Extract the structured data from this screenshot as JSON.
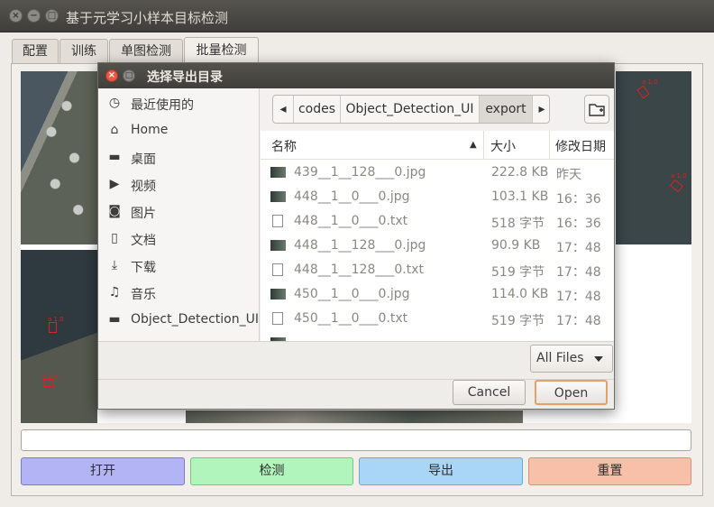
{
  "window": {
    "title": "基于元学习小样本目标检测",
    "close_glyph": "×",
    "min_glyph": "−",
    "max_glyph": "□"
  },
  "tabs": [
    {
      "label": "配置"
    },
    {
      "label": "训练"
    },
    {
      "label": "单图检测"
    },
    {
      "label": "批量检测",
      "active": true
    }
  ],
  "detections": [
    {
      "label": "a 1.0"
    },
    {
      "label": "a 1.0"
    },
    {
      "label": "a 1.0"
    },
    {
      "label": "a 1.0"
    }
  ],
  "path_input": {
    "value": ""
  },
  "actions": [
    {
      "label": "打开",
      "color": "#b3b4f5"
    },
    {
      "label": "检测",
      "color": "#b2f5bc"
    },
    {
      "label": "导出",
      "color": "#a9d6f7"
    },
    {
      "label": "重置",
      "color": "#f8c0a8"
    }
  ],
  "dialog": {
    "title": "选择导出目录",
    "places": [
      {
        "icon": "clock-icon",
        "glyph": "◷",
        "label": "最近使用的"
      },
      {
        "icon": "home-icon",
        "glyph": "⌂",
        "label": "Home"
      },
      {
        "icon": "folder-icon",
        "glyph": "▬",
        "label": "桌面"
      },
      {
        "icon": "video-icon",
        "glyph": "▶",
        "label": "视频"
      },
      {
        "icon": "camera-icon",
        "glyph": "◙",
        "label": "图片"
      },
      {
        "icon": "document-icon",
        "glyph": "▯",
        "label": "文档"
      },
      {
        "icon": "download-icon",
        "glyph": "⤓",
        "label": "下载"
      },
      {
        "icon": "music-icon",
        "glyph": "♫",
        "label": "音乐"
      },
      {
        "icon": "folder-icon",
        "glyph": "▬",
        "label": "Object_Detection_UI"
      }
    ],
    "breadcrumb": {
      "prev_glyph": "◂",
      "next_glyph": "▸",
      "items": [
        {
          "label": "codes"
        },
        {
          "label": "Object_Detection_UI"
        },
        {
          "label": "export",
          "active": true
        }
      ]
    },
    "columns": {
      "name": "名称",
      "size": "大小",
      "modified": "修改日期",
      "sort_glyph": "▲"
    },
    "files": [
      {
        "name": "439__1__128___0.jpg",
        "size": "222.8 KB",
        "modified": "昨天",
        "kind": "image"
      },
      {
        "name": "448__1__0___0.jpg",
        "size": "103.1 KB",
        "modified": "16：36",
        "kind": "image"
      },
      {
        "name": "448__1__0___0.txt",
        "size": "518 字节",
        "modified": "16：36",
        "kind": "text"
      },
      {
        "name": "448__1__128___0.jpg",
        "size": "90.9 KB",
        "modified": "17：48",
        "kind": "image"
      },
      {
        "name": "448__1__128___0.txt",
        "size": "519 字节",
        "modified": "17：48",
        "kind": "text"
      },
      {
        "name": "450__1__0___0.jpg",
        "size": "114.0 KB",
        "modified": "17：48",
        "kind": "image"
      },
      {
        "name": "450__1__0___0.txt",
        "size": "519 字节",
        "modified": "17：48",
        "kind": "text"
      }
    ],
    "filter": {
      "value": "All Files"
    },
    "cancel_label": "Cancel",
    "open_label": "Open"
  }
}
